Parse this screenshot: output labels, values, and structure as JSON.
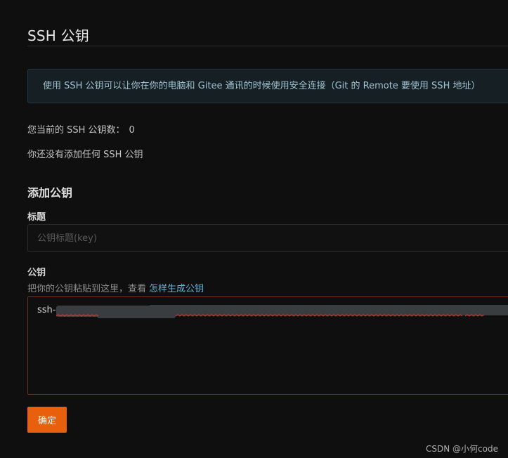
{
  "page": {
    "title": "SSH 公钥"
  },
  "info": {
    "text": "使用 SSH 公钥可以让你在你的电脑和 Gitee 通讯的时候使用安全连接（Git 的 Remote 要使用 SSH 地址）"
  },
  "status": {
    "count_label": "您当前的 SSH 公钥数：",
    "count_value": "0",
    "empty_message": "你还没有添加任何 SSH 公钥"
  },
  "form": {
    "section_title": "添加公钥",
    "title_label": "标题",
    "title_placeholder": "公钥标题(key)",
    "title_value": "",
    "key_label": "公钥",
    "key_hint": "把你的公钥粘贴到这里，查看",
    "key_help_link": "怎样生成公钥",
    "key_value_visible": "ssh-e",
    "submit_label": "确定"
  },
  "watermark": "CSDN @小何code",
  "colors": {
    "background": "#0f0f0f",
    "accent_button": "#e8600e",
    "info_text": "#9fc3cf",
    "link": "#5fb3d9",
    "error_border": "#6b3320"
  }
}
